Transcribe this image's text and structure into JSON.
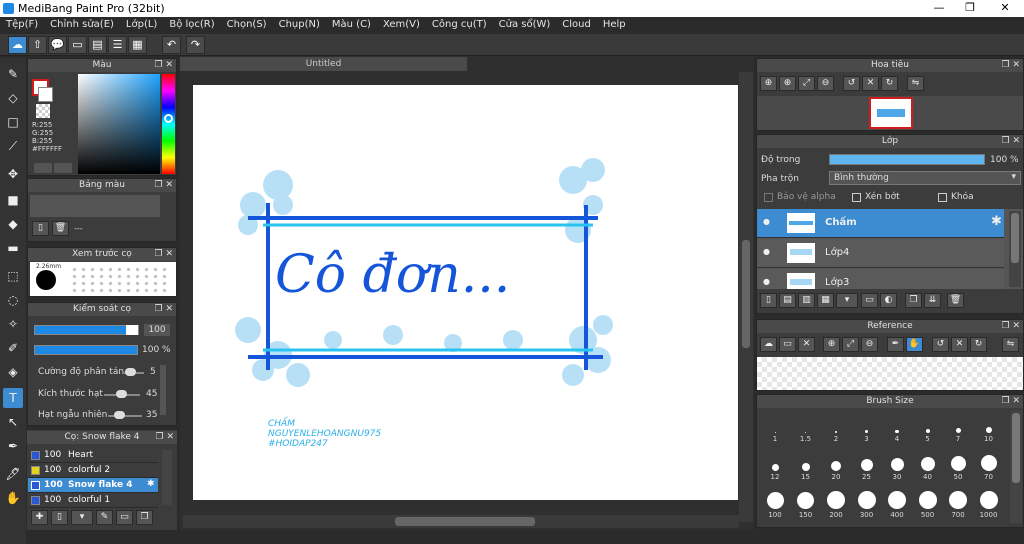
{
  "window": {
    "title": "MediBang Paint Pro (32bit)",
    "min": "—",
    "restore": "❐",
    "close": "✕"
  },
  "menu": [
    "Tệp(F)",
    "Chỉnh sửa(E)",
    "Lớp(L)",
    "Bộ lọc(R)",
    "Chọn(S)",
    "Chụp(N)",
    "Màu (C)",
    "Xem(V)",
    "Công cụ(T)",
    "Cửa sổ(W)",
    "Cloud",
    "Help"
  ],
  "color_panel": {
    "title": "Màu",
    "r": "R:255",
    "g": "G:255",
    "b": "B:255",
    "hex": "#FFFFFF"
  },
  "palette_panel": {
    "title": "Bảng màu",
    "dashes": "---"
  },
  "brush_preview": {
    "title": "Xem trước cọ",
    "label": "2.26mm"
  },
  "brush_control": {
    "title": "Kiểm soát cọ",
    "size_value": "100",
    "opacity_value": "100 %",
    "opacity_fraction": 1.0,
    "params": [
      {
        "label": "Cường độ phân tán",
        "value": "5"
      },
      {
        "label": "Kích thước hạt",
        "value": "45"
      },
      {
        "label": "Hạt ngẫu nhiên",
        "value": "35"
      }
    ]
  },
  "brushes": {
    "title": "Cọ: Snow flake 4",
    "items": [
      {
        "opacity": "100",
        "name": "Heart",
        "color": "#2a57d4"
      },
      {
        "opacity": "100",
        "name": "colorful 2",
        "color": "#e5d21b"
      },
      {
        "opacity": "100",
        "name": "Snow flake 4",
        "color": "#2a57d4",
        "selected": true
      },
      {
        "opacity": "100",
        "name": "colorful 1",
        "color": "#2a57d4"
      }
    ]
  },
  "document": {
    "tab": "Untitled",
    "art": {
      "main": "Cô đơn...",
      "credit_1": "CHẤM",
      "credit_2": "NGUYENLEHOANGNU975",
      "credit_3": "#HOIDAP247"
    }
  },
  "navigator": {
    "title": "Hoa tiêu"
  },
  "layers": {
    "title": "Lớp",
    "opacity_label": "Độ trong",
    "opacity_value": "100 %",
    "opacity_fraction": 1.0,
    "blend_label": "Pha trộn",
    "blend_value": "Bình thường",
    "protect_alpha": "Bảo vệ alpha",
    "clipping": "Xén bớt",
    "lock": "Khóa",
    "items": [
      {
        "name": "Chấm",
        "selected": true
      },
      {
        "name": "Lớp4"
      },
      {
        "name": "Lớp3"
      }
    ]
  },
  "reference": {
    "title": "Reference"
  },
  "brush_size": {
    "title": "Brush Size",
    "sizes": [
      "1",
      "1.5",
      "2",
      "3",
      "4",
      "5",
      "7",
      "10",
      "12",
      "15",
      "20",
      "25",
      "30",
      "40",
      "50",
      "70",
      "100",
      "150",
      "200",
      "300",
      "400",
      "500",
      "700",
      "1000"
    ]
  },
  "colors": {
    "accent": "#3d8bd1",
    "panel": "#3c3c3c",
    "header": "#4a4a4a"
  }
}
